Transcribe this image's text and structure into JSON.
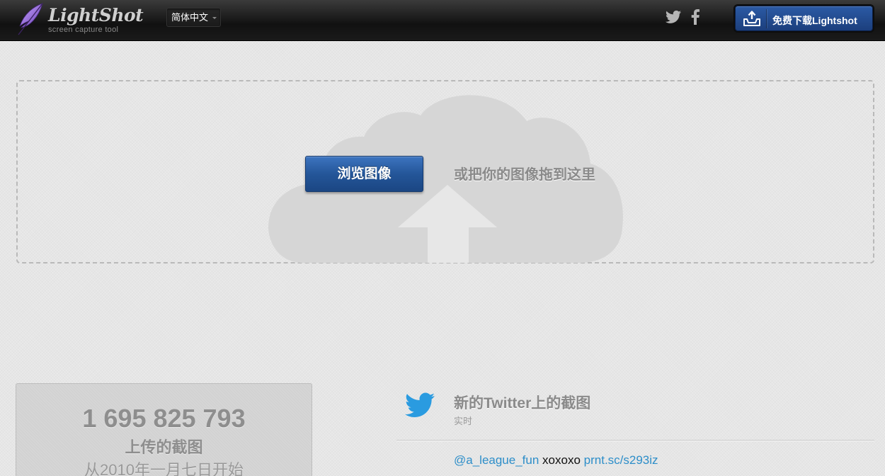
{
  "header": {
    "logo_name": "LightShot",
    "logo_tagline": "screen capture tool",
    "language": "简体中文",
    "social": [
      "twitter-icon",
      "facebook-icon"
    ],
    "download_label": "免费下载Lightshot"
  },
  "upload": {
    "browse_label": "浏览图像",
    "drop_hint": "或把你的图像拖到这里",
    "background_icon": "cloud-upload-icon"
  },
  "stats": {
    "count": "1 695 825 793",
    "caption": "上传的截图",
    "since": "从2010年一月七日开始"
  },
  "twitter_feed": {
    "title": "新的Twitter上的截图",
    "subtitle": "实时",
    "tweets": [
      {
        "handle": "@a_league_fun",
        "text": "xoxoxo",
        "link": "prnt.sc/s293iz"
      }
    ]
  },
  "colors": {
    "accent": "#245699",
    "link": "#2d8ec9",
    "header_bg": "#1a1a1a"
  }
}
